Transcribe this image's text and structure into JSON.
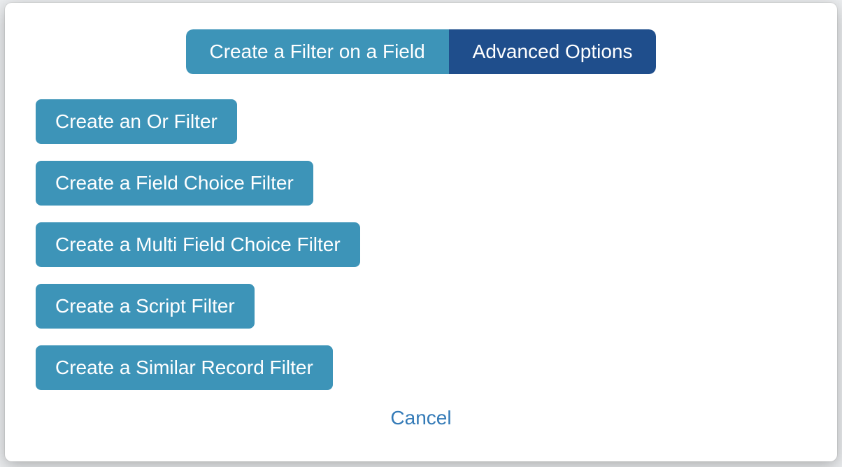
{
  "tabs": {
    "field_filter": "Create a Filter on a Field",
    "advanced": "Advanced Options",
    "active": "advanced"
  },
  "advanced_options": {
    "or_filter": "Create an Or Filter",
    "field_choice_filter": "Create a Field Choice Filter",
    "multi_field_choice": "Create a Multi Field Choice Filter",
    "script_filter": "Create a Script Filter",
    "similar_record_filter": "Create a Similar Record Filter"
  },
  "actions": {
    "cancel": "Cancel"
  },
  "colors": {
    "tab_inactive": "#3d94b8",
    "tab_active": "#1f4e8c",
    "button": "#3d94b8",
    "link": "#337ab7"
  }
}
